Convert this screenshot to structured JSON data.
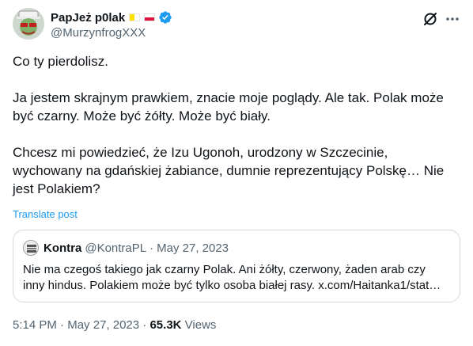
{
  "author": {
    "display_name": "PapJeż p0lak",
    "handle": "@MurzynfrogXXX",
    "badge_icon": "verified-badge-icon",
    "accent": "#1d9bf0"
  },
  "tweet": {
    "paragraphs": [
      "Co ty pierdolisz.",
      "Ja jestem skrajnym prawkiem, znacie moje poglądy. Ale tak. Polak może być czarny. Może być żółty. Może być biały.",
      "Chcesz mi powiedzieć, że Izu Ugonoh, urodzony w Szczecinie, wychowany na gdańskiej żabiance, dumnie reprezentujący Polskę… Nie jest Polakiem?"
    ],
    "translate_label": "Translate post"
  },
  "quote": {
    "name": "Kontra",
    "handle": "@KontraPL",
    "separator": "·",
    "date": "May 27, 2023",
    "text": "Nie ma czegoś takiego jak czarny Polak. Ani żółty, czerwony, żaden arab czy inny hindus. Polakiem może być tylko osoba białej rasy. x.com/Haitanka1/stat…"
  },
  "meta": {
    "time": "5:14 PM",
    "sep1": "·",
    "date": "May 27, 2023",
    "sep2": "·",
    "views_count": "65.3K",
    "views_label": "Views"
  }
}
